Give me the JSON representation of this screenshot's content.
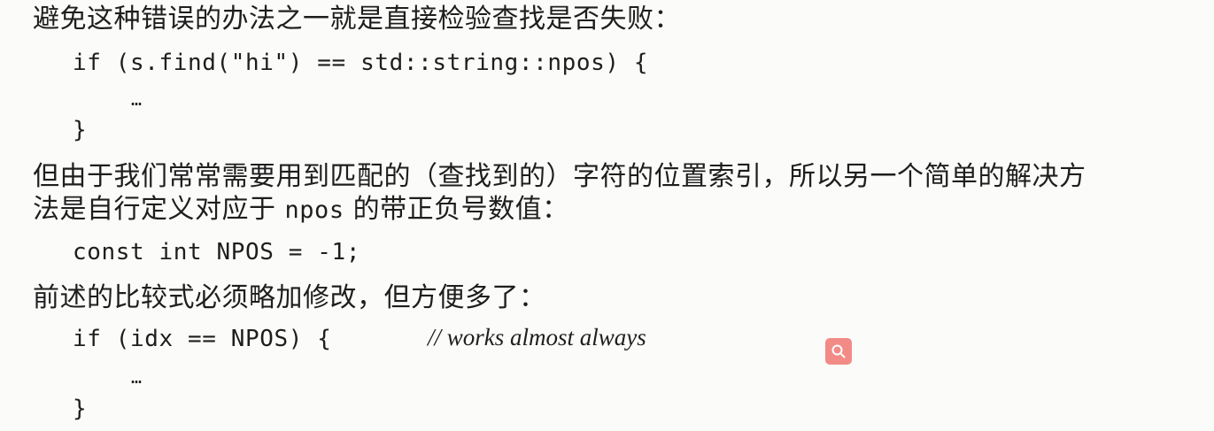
{
  "text": {
    "line1": "避免这种错误的办法之一就是直接检验查找是否失败：",
    "code1": {
      "line1": "if (s.find(\"hi\") == std::string::npos) {",
      "line2": "…",
      "line3": "}"
    },
    "para2": {
      "line1": "但由于我们常常需要用到匹配的（查找到的）字符的位置索引，所以另一个简单的解决方",
      "line2_pre": "法是自行定义对应于 ",
      "line2_code": "npos",
      "line2_post": " 的带正负号数值："
    },
    "code2": "const int NPOS = -1;",
    "line4": "前述的比较式必须略加修改，但方便多了：",
    "code3": {
      "line1": "if (idx == NPOS) {",
      "comment": "// works almost always",
      "line2": "…",
      "line3": "}"
    }
  },
  "search_button": {
    "icon": "search-icon",
    "color": "#f28b86"
  }
}
